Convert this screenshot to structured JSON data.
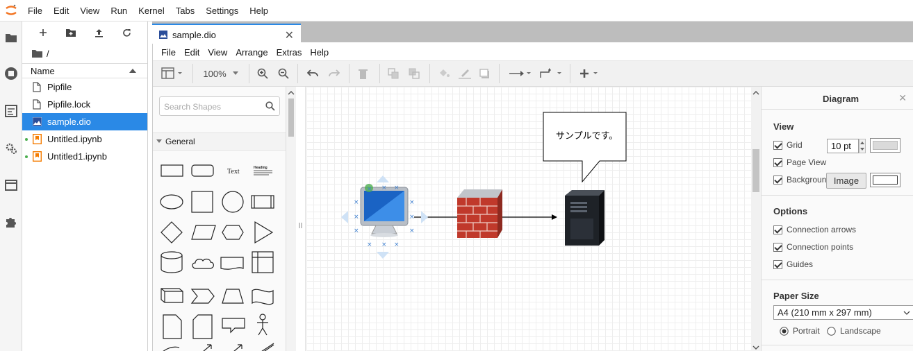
{
  "top_menu": [
    "File",
    "Edit",
    "View",
    "Run",
    "Kernel",
    "Tabs",
    "Settings",
    "Help"
  ],
  "file_browser": {
    "breadcrumb": "/",
    "column_name": "Name",
    "files": [
      {
        "name": "Pipfile",
        "type": "file",
        "selected": false,
        "running": false
      },
      {
        "name": "Pipfile.lock",
        "type": "file",
        "selected": false,
        "running": false
      },
      {
        "name": "sample.dio",
        "type": "dio",
        "selected": true,
        "running": false
      },
      {
        "name": "Untitled.ipynb",
        "type": "notebook",
        "selected": false,
        "running": true
      },
      {
        "name": "Untitled1.ipynb",
        "type": "notebook",
        "selected": false,
        "running": true
      }
    ]
  },
  "tab": {
    "title": "sample.dio",
    "close": "✕"
  },
  "drawio": {
    "menu": [
      "File",
      "Edit",
      "View",
      "Arrange",
      "Extras",
      "Help"
    ],
    "zoom": "100%",
    "search_placeholder": "Search Shapes",
    "palette_header": "General",
    "shape_text_label": "Text",
    "shape_heading_label": "Heading",
    "callout_text": "サンプルです。",
    "format_panel": {
      "title": "Diagram",
      "close": "✕",
      "view_header": "View",
      "grid_label": "Grid",
      "grid_size": "10 pt",
      "page_view_label": "Page View",
      "background_label": "Backgroun",
      "image_button": "Image",
      "options_header": "Options",
      "connection_arrows": "Connection arrows",
      "connection_points": "Connection points",
      "guides": "Guides",
      "paper_size_header": "Paper Size",
      "paper_size_value": "A4 (210 mm x 297 mm)",
      "portrait": "Portrait",
      "landscape": "Landscape",
      "orientation": "Portrait"
    }
  },
  "colors": {
    "accent": "#2a89e6",
    "selection_handle": "#4caf50",
    "firewall_red": "#c0392b"
  }
}
